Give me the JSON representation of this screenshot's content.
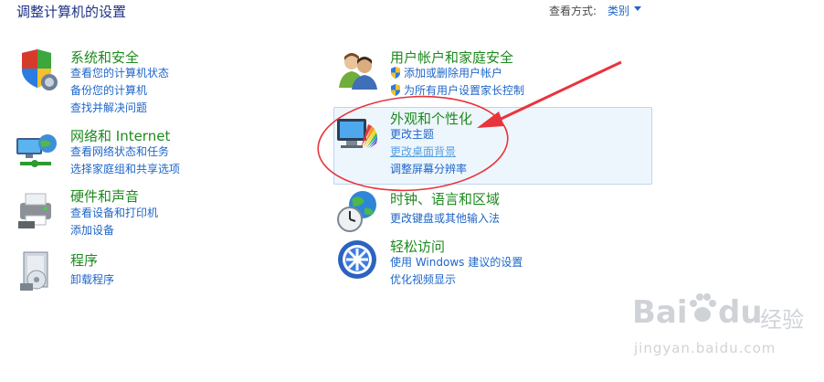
{
  "header": {
    "title": "调整计算机的设置",
    "view_by_label": "查看方式:",
    "view_by_value": "类别"
  },
  "categories": [
    {
      "title": "系统和安全",
      "icon": "shield-security-icon",
      "links": [
        "查看您的计算机状态",
        "备份您的计算机",
        "查找并解决问题"
      ]
    },
    {
      "title": "网络和 Internet",
      "icon": "network-icon",
      "links": [
        "查看网络状态和任务",
        "选择家庭组和共享选项"
      ]
    },
    {
      "title": "硬件和声音",
      "icon": "printer-hardware-icon",
      "links": [
        "查看设备和打印机",
        "添加设备"
      ]
    },
    {
      "title": "程序",
      "icon": "programs-icon",
      "links": [
        "卸载程序"
      ]
    },
    {
      "title": "用户帐户和家庭安全",
      "icon": "users-icon",
      "links": [
        "添加或删除用户帐户",
        "为所有用户设置家长控制"
      ]
    },
    {
      "title": "外观和个性化",
      "icon": "appearance-monitor-icon",
      "links": [
        "更改主题",
        "更改桌面背景",
        "调整屏幕分辨率"
      ]
    },
    {
      "title": "时钟、语言和区域",
      "icon": "clock-globe-icon",
      "links": [
        "更改键盘或其他输入法"
      ]
    },
    {
      "title": "轻松访问",
      "icon": "ease-of-access-icon",
      "links": [
        "使用 Windows 建议的设置",
        "优化视频显示"
      ]
    }
  ],
  "watermark": {
    "brand": "Bai",
    "brand2": "du",
    "suffix": "经验",
    "url": "jingyan.baidu.com"
  },
  "colors": {
    "category_title": "#1e8a1e",
    "link": "#1e66c8",
    "highlight_bg": "#eef6fd",
    "annotation": "#e8343c"
  }
}
